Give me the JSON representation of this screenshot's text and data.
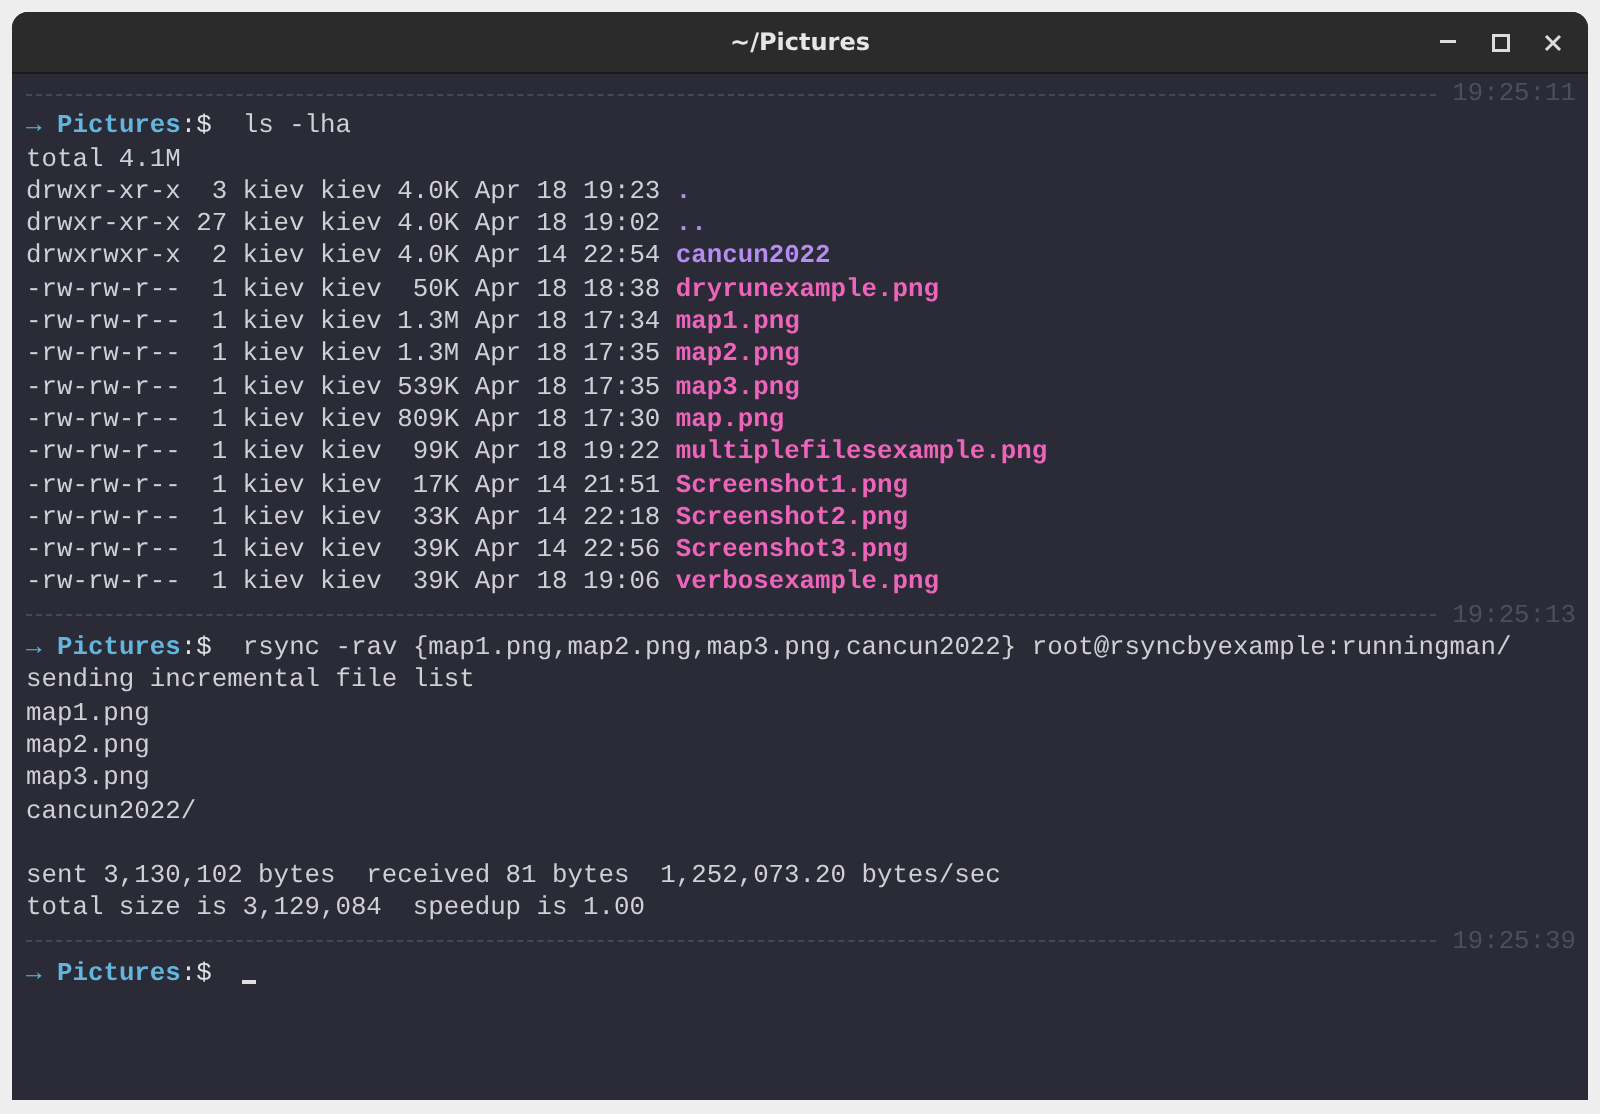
{
  "window": {
    "title": "~/Pictures"
  },
  "blocks": [
    {
      "timestamp": "19:25:11",
      "prompt": {
        "arrow": "→",
        "directory": "Pictures",
        "symbol": ":$",
        "command": "ls -lha"
      },
      "output": [
        {
          "kind": "text",
          "text": "total 4.1M"
        },
        {
          "kind": "dir",
          "meta": "drwxr-xr-x  3 kiev kiev 4.0K Apr 18 19:23",
          "name": "."
        },
        {
          "kind": "dir",
          "meta": "drwxr-xr-x 27 kiev kiev 4.0K Apr 18 19:02",
          "name": ".."
        },
        {
          "kind": "dir",
          "meta": "drwxrwxr-x  2 kiev kiev 4.0K Apr 14 22:54",
          "name": "cancun2022"
        },
        {
          "kind": "file",
          "meta": "-rw-rw-r--  1 kiev kiev  50K Apr 18 18:38",
          "name": "dryrunexample.png"
        },
        {
          "kind": "file",
          "meta": "-rw-rw-r--  1 kiev kiev 1.3M Apr 18 17:34",
          "name": "map1.png"
        },
        {
          "kind": "file",
          "meta": "-rw-rw-r--  1 kiev kiev 1.3M Apr 18 17:35",
          "name": "map2.png"
        },
        {
          "kind": "file",
          "meta": "-rw-rw-r--  1 kiev kiev 539K Apr 18 17:35",
          "name": "map3.png"
        },
        {
          "kind": "file",
          "meta": "-rw-rw-r--  1 kiev kiev 809K Apr 18 17:30",
          "name": "map.png"
        },
        {
          "kind": "file",
          "meta": "-rw-rw-r--  1 kiev kiev  99K Apr 18 19:22",
          "name": "multiplefilesexample.png"
        },
        {
          "kind": "file",
          "meta": "-rw-rw-r--  1 kiev kiev  17K Apr 14 21:51",
          "name": "Screenshot1.png"
        },
        {
          "kind": "file",
          "meta": "-rw-rw-r--  1 kiev kiev  33K Apr 14 22:18",
          "name": "Screenshot2.png"
        },
        {
          "kind": "file",
          "meta": "-rw-rw-r--  1 kiev kiev  39K Apr 14 22:56",
          "name": "Screenshot3.png"
        },
        {
          "kind": "file",
          "meta": "-rw-rw-r--  1 kiev kiev  39K Apr 18 19:06",
          "name": "verbosexample.png"
        }
      ]
    },
    {
      "timestamp": "19:25:13",
      "prompt": {
        "arrow": "→",
        "directory": "Pictures",
        "symbol": ":$",
        "command": "rsync -rav {map1.png,map2.png,map3.png,cancun2022} root@rsyncbyexample:runningman/"
      },
      "output": [
        {
          "kind": "text",
          "text": "sending incremental file list"
        },
        {
          "kind": "text",
          "text": "map1.png"
        },
        {
          "kind": "text",
          "text": "map2.png"
        },
        {
          "kind": "text",
          "text": "map3.png"
        },
        {
          "kind": "text",
          "text": "cancun2022/"
        },
        {
          "kind": "blank"
        },
        {
          "kind": "text",
          "text": "sent 3,130,102 bytes  received 81 bytes  1,252,073.20 bytes/sec"
        },
        {
          "kind": "text",
          "text": "total size is 3,129,084  speedup is 1.00"
        }
      ]
    },
    {
      "timestamp": "19:25:39",
      "prompt": {
        "arrow": "→",
        "directory": "Pictures",
        "symbol": ":$"
      },
      "cursor": true
    }
  ]
}
